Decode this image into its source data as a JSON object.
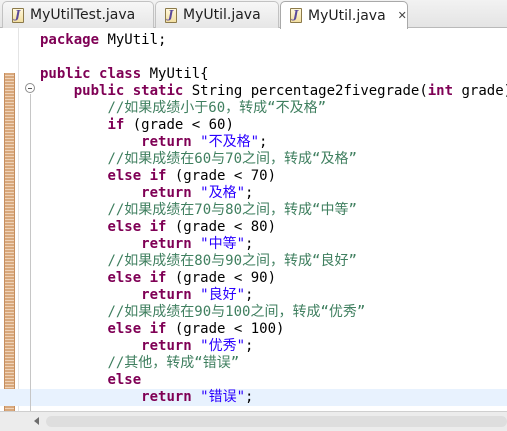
{
  "tabs": [
    {
      "label": "MyUtilTest.java",
      "closable": false,
      "active": false
    },
    {
      "label": "MyUtil.java",
      "closable": false,
      "active": false
    },
    {
      "label": "MyUtil.java",
      "closable": true,
      "active": true
    }
  ],
  "editor": {
    "current_line_index": 21,
    "lines": [
      [
        [
          "kw",
          "package"
        ],
        [
          "pl",
          " MyUtil;"
        ]
      ],
      [],
      [
        [
          "kw",
          "public"
        ],
        [
          "pl",
          " "
        ],
        [
          "kw",
          "class"
        ],
        [
          "pl",
          " MyUtil{"
        ]
      ],
      [
        [
          "pl",
          "    "
        ],
        [
          "kw",
          "public"
        ],
        [
          "pl",
          " "
        ],
        [
          "kw",
          "static"
        ],
        [
          "pl",
          " String percentage2fivegrade("
        ],
        [
          "kw",
          "int"
        ],
        [
          "pl",
          " grade){"
        ]
      ],
      [
        [
          "pl",
          "        "
        ],
        [
          "cmt",
          "//如果成绩小于60，转成“不及格”"
        ]
      ],
      [
        [
          "pl",
          "        "
        ],
        [
          "kw",
          "if"
        ],
        [
          "pl",
          " (grade < 60)"
        ]
      ],
      [
        [
          "pl",
          "            "
        ],
        [
          "kw",
          "return"
        ],
        [
          "pl",
          " "
        ],
        [
          "str",
          "\"不及格\""
        ],
        [
          "pl",
          ";"
        ]
      ],
      [
        [
          "pl",
          "        "
        ],
        [
          "cmt",
          "//如果成绩在60与70之间，转成“及格”"
        ]
      ],
      [
        [
          "pl",
          "        "
        ],
        [
          "kw",
          "else"
        ],
        [
          "pl",
          " "
        ],
        [
          "kw",
          "if"
        ],
        [
          "pl",
          " (grade < 70)"
        ]
      ],
      [
        [
          "pl",
          "            "
        ],
        [
          "kw",
          "return"
        ],
        [
          "pl",
          " "
        ],
        [
          "str",
          "\"及格\""
        ],
        [
          "pl",
          ";"
        ]
      ],
      [
        [
          "pl",
          "        "
        ],
        [
          "cmt",
          "//如果成绩在70与80之间，转成“中等”"
        ]
      ],
      [
        [
          "pl",
          "        "
        ],
        [
          "kw",
          "else"
        ],
        [
          "pl",
          " "
        ],
        [
          "kw",
          "if"
        ],
        [
          "pl",
          " (grade < 80)"
        ]
      ],
      [
        [
          "pl",
          "            "
        ],
        [
          "kw",
          "return"
        ],
        [
          "pl",
          " "
        ],
        [
          "str",
          "\"中等\""
        ],
        [
          "pl",
          ";"
        ]
      ],
      [
        [
          "pl",
          "        "
        ],
        [
          "cmt",
          "//如果成绩在80与90之间，转成“良好”"
        ]
      ],
      [
        [
          "pl",
          "        "
        ],
        [
          "kw",
          "else"
        ],
        [
          "pl",
          " "
        ],
        [
          "kw",
          "if"
        ],
        [
          "pl",
          " (grade < 90)"
        ]
      ],
      [
        [
          "pl",
          "            "
        ],
        [
          "kw",
          "return"
        ],
        [
          "pl",
          " "
        ],
        [
          "str",
          "\"良好\""
        ],
        [
          "pl",
          ";"
        ]
      ],
      [
        [
          "pl",
          "        "
        ],
        [
          "cmt",
          "//如果成绩在90与100之间，转成“优秀”"
        ]
      ],
      [
        [
          "pl",
          "        "
        ],
        [
          "kw",
          "else"
        ],
        [
          "pl",
          " "
        ],
        [
          "kw",
          "if"
        ],
        [
          "pl",
          " (grade < 100)"
        ]
      ],
      [
        [
          "pl",
          "            "
        ],
        [
          "kw",
          "return"
        ],
        [
          "pl",
          " "
        ],
        [
          "str",
          "\"优秀\""
        ],
        [
          "pl",
          ";"
        ]
      ],
      [
        [
          "pl",
          "        "
        ],
        [
          "cmt",
          "//其他，转成“错误”"
        ]
      ],
      [
        [
          "pl",
          "        "
        ],
        [
          "kw",
          "else"
        ]
      ],
      [
        [
          "pl",
          "            "
        ],
        [
          "kw",
          "return"
        ],
        [
          "pl",
          " "
        ],
        [
          "str",
          "\"错误\""
        ],
        [
          "pl",
          ";"
        ]
      ]
    ]
  },
  "colors": {
    "keyword": "#7f0055",
    "string": "#2a00ff",
    "comment": "#3f7f5f",
    "current_line": "#e8f2fe",
    "change_marker": "#d8a87c"
  },
  "icons": {
    "tab_file": "java-file-icon",
    "tab_close": "close-icon",
    "fold": "fold-collapse-icon",
    "scroll_left": "scroll-left-arrow-icon"
  }
}
